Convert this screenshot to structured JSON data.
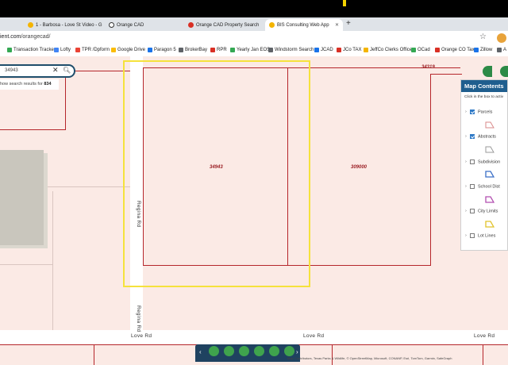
{
  "browser": {
    "tabs": [
      {
        "label": "1 - Barbosa - Love St Video - G",
        "active": false,
        "color": "#f4b400"
      },
      {
        "label": "Orange CAD",
        "active": false,
        "color": "#333333"
      },
      {
        "label": "Orange CAD Property Search",
        "active": false,
        "color": "#d93025"
      },
      {
        "label": "BIS Consulting Web App",
        "active": true,
        "color": "#f4b400"
      }
    ],
    "new_tab": "+",
    "url_host": "ient.com",
    "url_path": "/orangecad/"
  },
  "bookmarks": [
    {
      "label": "Transaction Tracker",
      "color": "#34a853"
    },
    {
      "label": "Lofty",
      "color": "#4285f4"
    },
    {
      "label": "TPR /Dpform",
      "color": "#ea4335"
    },
    {
      "label": "Google Drive",
      "color": "#fbbc05"
    },
    {
      "label": "Paragon 5",
      "color": "#1a73e8"
    },
    {
      "label": "BrokerBay",
      "color": "#5f6368"
    },
    {
      "label": "RPR",
      "color": "#d93025"
    },
    {
      "label": "Yearly Jan EOS",
      "color": "#34a853"
    },
    {
      "label": "Windstorm Search",
      "color": "#5f6368"
    },
    {
      "label": "JCAD",
      "color": "#1a73e8"
    },
    {
      "label": "JCo TAX",
      "color": "#d93025"
    },
    {
      "label": "JeffCo Clerks Office",
      "color": "#f4b400"
    },
    {
      "label": "OCad",
      "color": "#34a853"
    },
    {
      "label": "Orange CO Tax",
      "color": "#d93025"
    },
    {
      "label": "Zillow",
      "color": "#1a73e8"
    },
    {
      "label": "A",
      "color": "#5f6368"
    }
  ],
  "search": {
    "value": "34943",
    "results_prefix": "how search results for ",
    "results_term": "834"
  },
  "map_labels": {
    "parcel_1": "34943",
    "parcel_2": "309000",
    "parcel_3": "34319",
    "regina_rd_upper": "Regina Rd",
    "regina_rd_lower": "Regina Rd",
    "love_rd_left": "Love Rd",
    "love_rd_mid": "Love Rd",
    "love_rd_right": "Love Rd",
    "attribution": "Map Contributors, Texas Parks & Wildlife, © OpenStreetMap, Microsoft, CONANP, Esri, TomTom, Garmin, SafeGraph"
  },
  "map_contents": {
    "title": "Map Contents",
    "hint": "Click in the box to activ",
    "layers": [
      {
        "label": "Parcels",
        "checked": true,
        "legend_color": "#d98a8a"
      },
      {
        "label": "Abstracts",
        "checked": true,
        "legend_color": "#9a9a9a"
      },
      {
        "label": "Subdivision",
        "checked": false,
        "legend_color": "#3b6fc7"
      },
      {
        "label": "School Dist",
        "checked": false,
        "legend_color": "#b24fb0"
      },
      {
        "label": "City Limits",
        "checked": false,
        "legend_color": "#e1c22a"
      },
      {
        "label": "Lot Lines",
        "checked": false,
        "legend_color": ""
      }
    ]
  },
  "toolbar": {
    "prev": "‹",
    "next": "›"
  },
  "colors": {
    "map_bg": "#fbeae5",
    "parcel_line": "#b5262b",
    "highlight": "#f5e23c",
    "panel_header": "#1f5e8e",
    "toolbar_bg": "#1f4260"
  }
}
